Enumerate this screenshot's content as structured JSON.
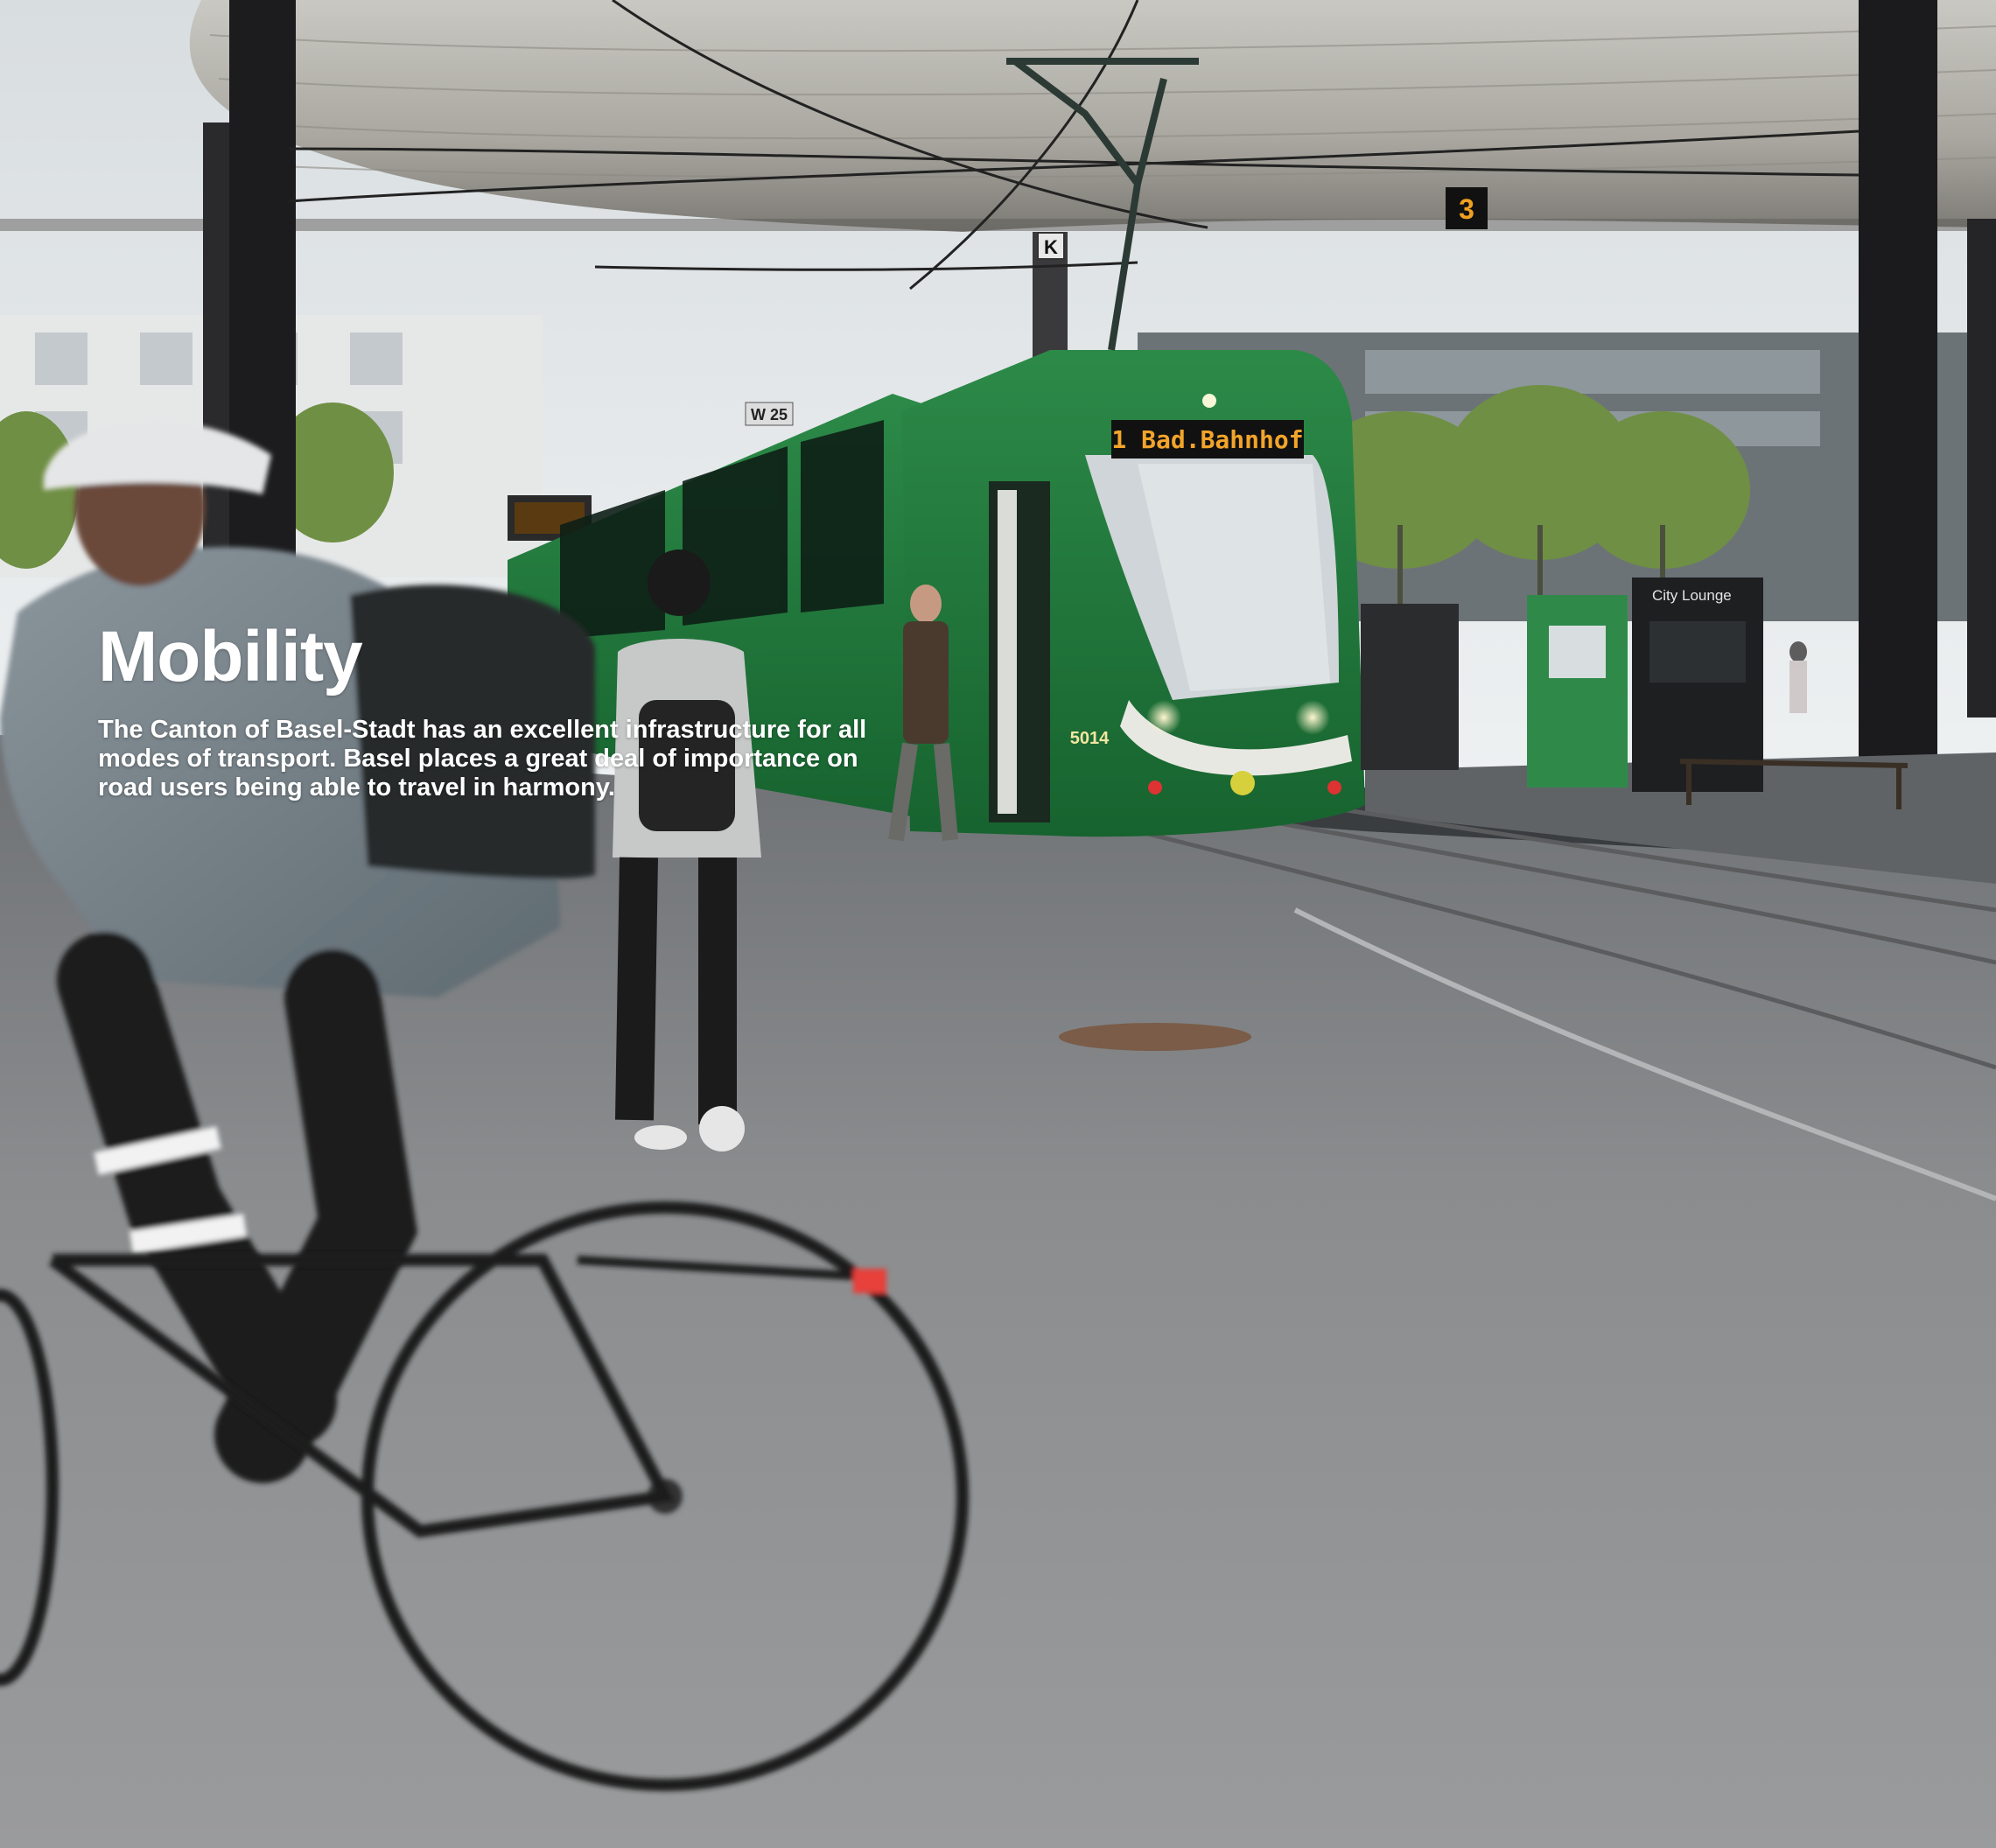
{
  "article": {
    "title": "Mobility",
    "intro": "The Canton of Basel-Stadt has an excellent infrastructure for all modes of transport. Basel places a great deal of importance on road users being able to travel in harmony."
  },
  "photo": {
    "tram_destination": "1 Bad.Bahnhof",
    "tram_number": "5014",
    "platform_sign": "K",
    "stop_sign": "W 25",
    "overhead_sign": "3",
    "lounge_sign": "City Lounge"
  },
  "colors": {
    "tram_green": "#1f7a3c",
    "asphalt": "#8f9193",
    "headline_text": "#ffffff"
  }
}
